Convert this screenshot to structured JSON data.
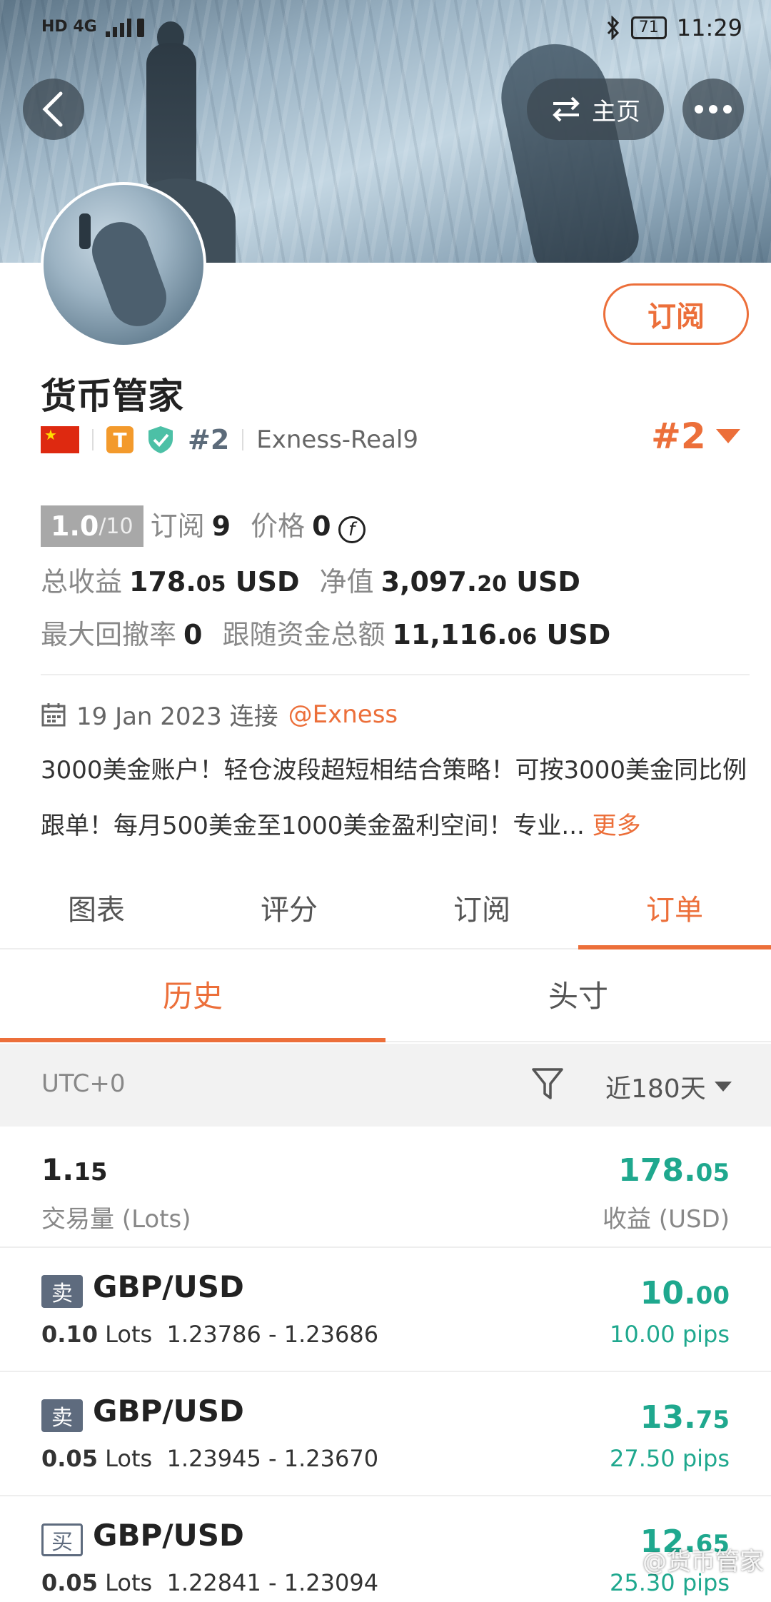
{
  "status_bar": {
    "left_indicators": "HD 4G",
    "battery": "71",
    "time": "11:29"
  },
  "header": {
    "home_label": "主页"
  },
  "profile": {
    "name": "货币管家",
    "subscribe_label": "订阅",
    "badge_letter": "T",
    "rank_small": "#2",
    "server": "Exness-Real9",
    "rank_big": "#2",
    "score_main": "1.0",
    "score_max": "/10",
    "subscribers_label": "订阅",
    "subscribers_value": "9",
    "price_label": "价格",
    "price_value": "0",
    "total_profit_label": "总收益",
    "total_profit_int": "178.",
    "total_profit_dec": "05",
    "total_profit_unit": "USD",
    "equity_label": "净值",
    "equity_int": "3,097.",
    "equity_dec": "20",
    "equity_unit": "USD",
    "drawdown_label": "最大回撤率",
    "drawdown_value": "0",
    "follow_funds_label": "跟随资金总额",
    "follow_funds_int": "11,116.",
    "follow_funds_dec": "06",
    "follow_funds_unit": "USD",
    "connect_date": "19 Jan 2023 连接",
    "connect_broker": "@Exness",
    "description": "3000美金账户！轻仓波段超短相结合策略！可按3000美金同比例跟单！每月500美金至1000美金盈利空间！专业...",
    "more_label": "更多"
  },
  "tabs": [
    {
      "label": "图表"
    },
    {
      "label": "评分"
    },
    {
      "label": "订阅"
    },
    {
      "label": "订单"
    }
  ],
  "subtabs": [
    {
      "label": "历史"
    },
    {
      "label": "头寸"
    }
  ],
  "filter": {
    "timezone": "UTC+0",
    "range": "近180天"
  },
  "summary": {
    "lots_int": "1.",
    "lots_dec": "15",
    "lots_label": "交易量 (Lots)",
    "profit_int": "178.",
    "profit_dec": "05",
    "profit_label": "收益 (USD)"
  },
  "orders": [
    {
      "side": "卖",
      "pair": "GBP/USD",
      "lots": "0.10",
      "lots_unit": "Lots",
      "prices": "1.23786 - 1.23686",
      "profit_int": "10.",
      "profit_dec": "00",
      "pips": "10.00 pips"
    },
    {
      "side": "卖",
      "pair": "GBP/USD",
      "lots": "0.05",
      "lots_unit": "Lots",
      "prices": "1.23945 - 1.23670",
      "profit_int": "13.",
      "profit_dec": "75",
      "pips": "27.50 pips"
    },
    {
      "side": "买",
      "pair": "GBP/USD",
      "lots": "0.05",
      "lots_unit": "Lots",
      "prices": "1.22841 - 1.23094",
      "profit_int": "12.",
      "profit_dec": "65",
      "pips": "25.30 pips"
    }
  ],
  "watermark": "@货币管家",
  "colors": {
    "accent": "#ec6f3a",
    "profit": "#1fa88e",
    "sell_tag": "#5e6b7e"
  }
}
